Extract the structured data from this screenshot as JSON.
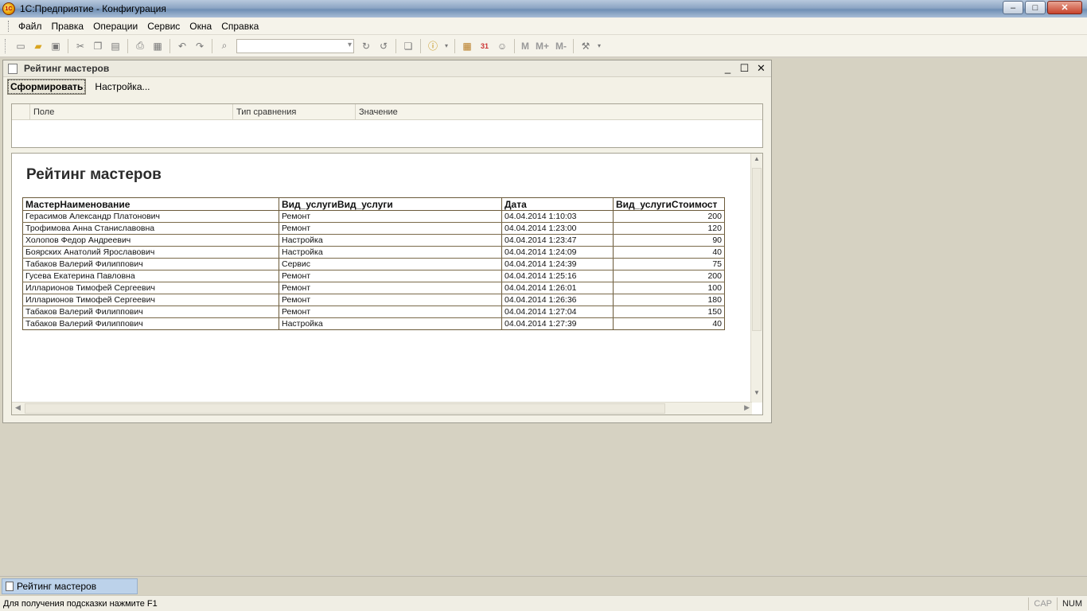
{
  "app": {
    "title": "1С:Предприятие - Конфигурация",
    "icon_text": "1C"
  },
  "window_buttons": {
    "minimize": "–",
    "maximize": "□",
    "close": "✕"
  },
  "menu": [
    {
      "label": "Файл"
    },
    {
      "label": "Правка"
    },
    {
      "label": "Операции"
    },
    {
      "label": "Сервис"
    },
    {
      "label": "Окна"
    },
    {
      "label": "Справка"
    }
  ],
  "toolbar": {
    "m": "M",
    "m_plus": "M+",
    "m_minus": "M-",
    "calendar": "31"
  },
  "report_window": {
    "title": "Рейтинг мастеров",
    "btn_generate": "Сформировать",
    "btn_settings": "Настройка...",
    "filter_columns": [
      "Поле",
      "Тип сравнения",
      "Значение"
    ],
    "report_title": "Рейтинг мастеров",
    "table": {
      "columns": [
        "МастерНаименование",
        "Вид_услугиВид_услуги",
        "Дата",
        "Вид_услугиСтоимост"
      ],
      "rows": [
        [
          "Герасимов   Александр   Платонович",
          "Ремонт",
          "04.04.2014 1:10:03",
          "200"
        ],
        [
          "Трофимова Анна Станиславовна",
          "Ремонт",
          "04.04.2014 1:23:00",
          "120"
        ],
        [
          "Холопов Федор Андреевич",
          "Настройка",
          "04.04.2014 1:23:47",
          "90"
        ],
        [
          "Боярских Анатолий Ярославович",
          "Настройка",
          "04.04.2014 1:24:09",
          "40"
        ],
        [
          "Табаков Валерий Филиппович",
          "Сервис",
          "04.04.2014 1:24:39",
          "75"
        ],
        [
          "Гусева   Екатерина  Павловна",
          "Ремонт",
          "04.04.2014 1:25:16",
          "200"
        ],
        [
          "Илларионов Тимофей Сергеевич",
          "Ремонт",
          "04.04.2014 1:26:01",
          "100"
        ],
        [
          "Илларионов Тимофей Сергеевич",
          "Ремонт",
          "04.04.2014 1:26:36",
          "180"
        ],
        [
          "Табаков Валерий Филиппович",
          "Ремонт",
          "04.04.2014 1:27:04",
          "150"
        ],
        [
          "Табаков Валерий Филиппович",
          "Настройка",
          "04.04.2014 1:27:39",
          "40"
        ]
      ]
    }
  },
  "window_tab": {
    "label": "Рейтинг мастеров"
  },
  "statusbar": {
    "hint": "Для получения подсказки нажмите F1",
    "cap": "CAP",
    "num": "NUM"
  }
}
